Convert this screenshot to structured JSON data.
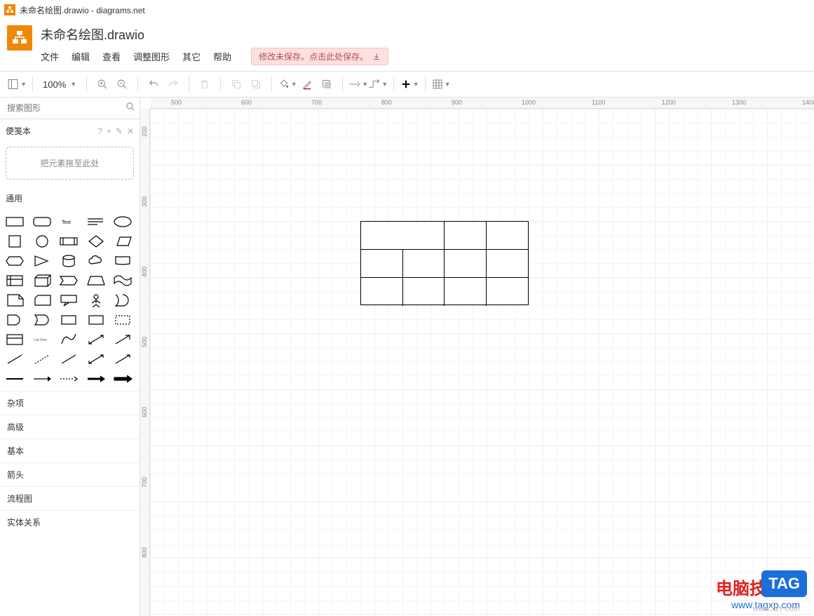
{
  "titlebar": {
    "text": "未命名绘图.drawio - diagrams.net"
  },
  "header": {
    "title": "未命名绘图.drawio"
  },
  "menu": {
    "items": [
      "文件",
      "编辑",
      "查看",
      "调整图形",
      "其它",
      "帮助"
    ],
    "save_label": "修改未保存。点击此处保存。"
  },
  "toolbar": {
    "zoom": "100%"
  },
  "sidebar": {
    "search_placeholder": "搜索图形",
    "scratch_label": "便笺本",
    "dropzone": "把元素拖至此处",
    "general_label": "通用",
    "categories": [
      "杂项",
      "高级",
      "基本",
      "箭头",
      "流程图",
      "实体关系"
    ]
  },
  "ruler_h": [
    "500",
    "600",
    "700",
    "800",
    "900",
    "1000",
    "1100",
    "1200",
    "1300",
    "1400"
  ],
  "ruler_v": [
    "200",
    "300",
    "400",
    "500",
    "600",
    "700",
    "800"
  ],
  "watermark": {
    "title": "电脑技术网",
    "url": "www.tagxp.com",
    "tag": "TAG",
    "sub": "www.xz7.com"
  }
}
